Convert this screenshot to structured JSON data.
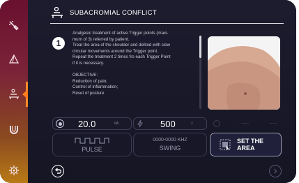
{
  "header": {
    "title": "SUBACROMIAL CONFLICT",
    "icon": "treatment-couch-icon"
  },
  "sidebar": {
    "items": [
      {
        "icon": "probe-tool-icon"
      },
      {
        "icon": "pyramid-icon"
      },
      {
        "icon": "treatment-couch-icon",
        "active": true
      },
      {
        "icon": "horseshoe-magnet-icon"
      },
      {
        "icon": "gear-icon"
      }
    ],
    "active_color": "#ff7a1a"
  },
  "protocol": {
    "step": "1",
    "lines": [
      "Analgesic treatment of active Trigger points (maxi-",
      "mum of 3) referred by patient.",
      "Treat the area of the shoulder and deltoid with slow",
      "circular movements around the Trigger point.",
      "Repeat the treatment 2 times fro each Trigger Point",
      "if it is necessary.",
      "",
      "OBJECTIVE:",
      "Reduction of pain;",
      "Control of inflammation;",
      "Reset of posture"
    ]
  },
  "controls": {
    "power": {
      "value": "20.0",
      "unit": "VA"
    },
    "pulses": {
      "value": "500",
      "unit": "J"
    },
    "mode": {
      "label": "PULSE"
    },
    "frequency": {
      "value": "0000-0000 KHZ",
      "label": "SWING"
    },
    "set_area": {
      "line1": "SET THE",
      "line2": "AREA"
    }
  },
  "nav": {
    "back_icon": "back-arrow-icon",
    "next_icon": "next-arrow-icon"
  },
  "colors": {
    "accent": "#ff7a1a",
    "background": "#1a1a2b",
    "sidebar_top": "#6a1030",
    "sidebar_bottom": "#b97a16"
  }
}
